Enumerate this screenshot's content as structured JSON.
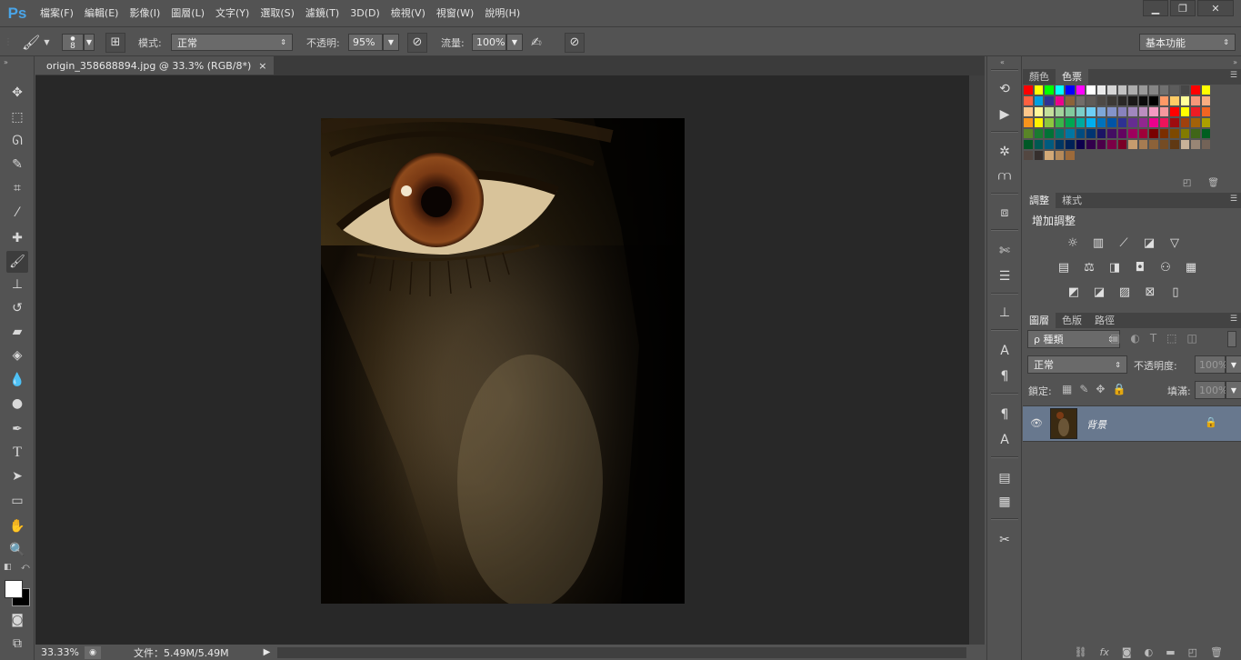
{
  "app": {
    "logo": "Ps",
    "workspace": "基本功能"
  },
  "menu": [
    "檔案(F)",
    "編輯(E)",
    "影像(I)",
    "圖層(L)",
    "文字(Y)",
    "選取(S)",
    "濾鏡(T)",
    "3D(D)",
    "檢視(V)",
    "視窗(W)",
    "說明(H)"
  ],
  "options": {
    "brush_size": "8",
    "mode_label": "模式:",
    "mode_value": "正常",
    "opacity_label": "不透明:",
    "opacity_value": "95%",
    "flow_label": "流量:",
    "flow_value": "100%"
  },
  "document": {
    "tab_title": "origin_358688894.jpg @ 33.3% (RGB/8*)",
    "close_glyph": "×"
  },
  "status": {
    "zoom": "33.33%",
    "doc_info": "文件：5.49M/5.49M"
  },
  "color_panel": {
    "tabs": [
      "顏色",
      "色票"
    ],
    "selected_tab": "色票"
  },
  "swatch_colors": [
    "#ff0000",
    "#ffff00",
    "#00ff00",
    "#00ffff",
    "#0000ff",
    "#ff00ff",
    "#ffffff",
    "#ebebeb",
    "#d6d6d6",
    "#c2c2c2",
    "#adadad",
    "#999999",
    "#858585",
    "#707070",
    "#5c5c5c",
    "#474747",
    "#ff0000",
    "#ffff00",
    "#ff6040",
    "#00a0e0",
    "#2e3192",
    "#ec008c",
    "#8c6239",
    "#726d6a",
    "#5f5b57",
    "#4d4945",
    "#3c3935",
    "#2a2826",
    "#1a1918",
    "#0a0a0a",
    "#000000",
    "#ff9966",
    "#ffcc66",
    "#ffff99",
    "#f7977a",
    "#f9ad81",
    "#fdc68a",
    "#fff79a",
    "#c4df9b",
    "#a2d39c",
    "#82ca9d",
    "#7bcdc8",
    "#6ecff6",
    "#7ea7d8",
    "#8493ca",
    "#8882be",
    "#a187be",
    "#bc8dbf",
    "#f49ac2",
    "#f6989d",
    "#ff0000",
    "#ffff00",
    "#ed1c24",
    "#f26522",
    "#f7941d",
    "#fff200",
    "#8dc73f",
    "#39b54a",
    "#00a651",
    "#00a99d",
    "#00aeef",
    "#0072bc",
    "#0054a6",
    "#2e3192",
    "#662d91",
    "#92278f",
    "#ec008c",
    "#ed145b",
    "#9e0b0f",
    "#a0410d",
    "#a36209",
    "#aba000",
    "#598527",
    "#1a7b30",
    "#007236",
    "#00746b",
    "#0076a3",
    "#004b80",
    "#003471",
    "#1b1464",
    "#440e62",
    "#630460",
    "#9e005d",
    "#9e0039",
    "#790000",
    "#7b2e00",
    "#7d4900",
    "#827b00",
    "#406618",
    "#005e20",
    "#005826",
    "#005952",
    "#005b7f",
    "#003663",
    "#002157",
    "#0d004c",
    "#32004b",
    "#4b0049",
    "#7b0046",
    "#7a0026",
    "#c69c6e",
    "#a67c52",
    "#8c6239",
    "#754c24",
    "#603913",
    "#c7b299",
    "#998675",
    "#736357",
    "#534741",
    "#362f2d",
    "#d2a977",
    "#b58a5a",
    "#9c6a3a"
  ],
  "adjustments_panel": {
    "tabs": [
      "調整",
      "樣式"
    ],
    "selected_tab": "調整",
    "heading": "增加調整"
  },
  "layers_panel": {
    "tabs": [
      "圖層",
      "色版",
      "路徑"
    ],
    "selected_tab": "圖層",
    "filter_label": "ρ 種類",
    "blend_mode": "正常",
    "opacity_label": "不透明度:",
    "opacity_value": "100%",
    "lock_label": "鎖定:",
    "fill_label": "填滿:",
    "fill_value": "100%",
    "layer_name": "背景",
    "fx_label": "fx"
  }
}
